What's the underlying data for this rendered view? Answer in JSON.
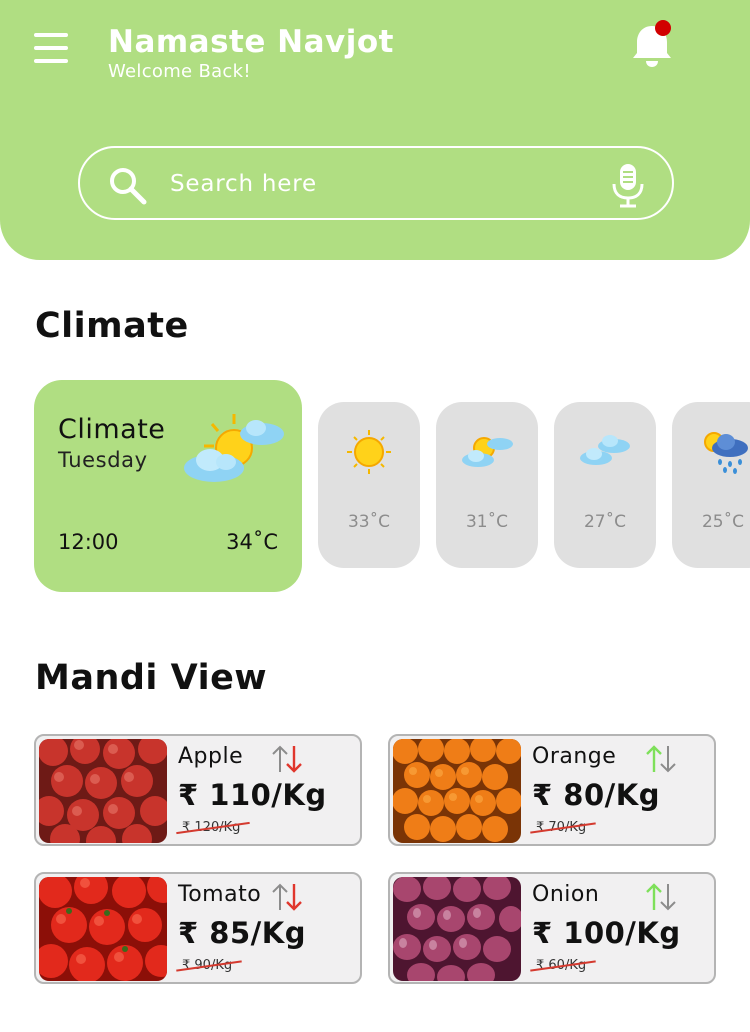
{
  "header": {
    "greeting": "Namaste Navjot",
    "subtitle": "Welcome Back!",
    "menu_icon": "hamburger-menu-icon",
    "notification_icon": "bell-icon",
    "has_unread_notification": true
  },
  "search": {
    "placeholder": "Search here",
    "value": "",
    "icon": "search-icon",
    "voice_icon": "microphone-icon"
  },
  "climate": {
    "section_title": "Climate",
    "current": {
      "title": "Climate",
      "day": "Tuesday",
      "time": "12:00",
      "temperature": "34˚C",
      "icon": "partly-cloudy-icon"
    },
    "forecast": [
      {
        "temperature": "33˚C",
        "icon": "sunny-icon"
      },
      {
        "temperature": "31˚C",
        "icon": "partly-cloudy-icon"
      },
      {
        "temperature": "27˚C",
        "icon": "cloudy-icon"
      },
      {
        "temperature": "25˚C",
        "icon": "rain-icon"
      }
    ]
  },
  "mandi": {
    "section_title": "Mandi View",
    "items": [
      {
        "name": "Apple",
        "price": "₹ 110/Kg",
        "old_price": "₹ 120/Kg",
        "trend": "down",
        "image": "apples-photo"
      },
      {
        "name": "Orange",
        "price": "₹ 80/Kg",
        "old_price": "₹ 70/Kg",
        "trend": "up",
        "image": "oranges-photo"
      },
      {
        "name": "Tomato",
        "price": "₹ 85/Kg",
        "old_price": "₹ 90/Kg",
        "trend": "down",
        "image": "tomatoes-photo"
      },
      {
        "name": "Onion",
        "price": "₹ 100/Kg",
        "old_price": "₹ 60/Kg",
        "trend": "up",
        "image": "onions-photo"
      }
    ]
  },
  "colors": {
    "accent_green": "#b0de82",
    "card_grey": "#e0e0e0",
    "trend_up": "#7ee05a",
    "trend_down": "#e0362c",
    "notification_dot": "#d10000"
  }
}
